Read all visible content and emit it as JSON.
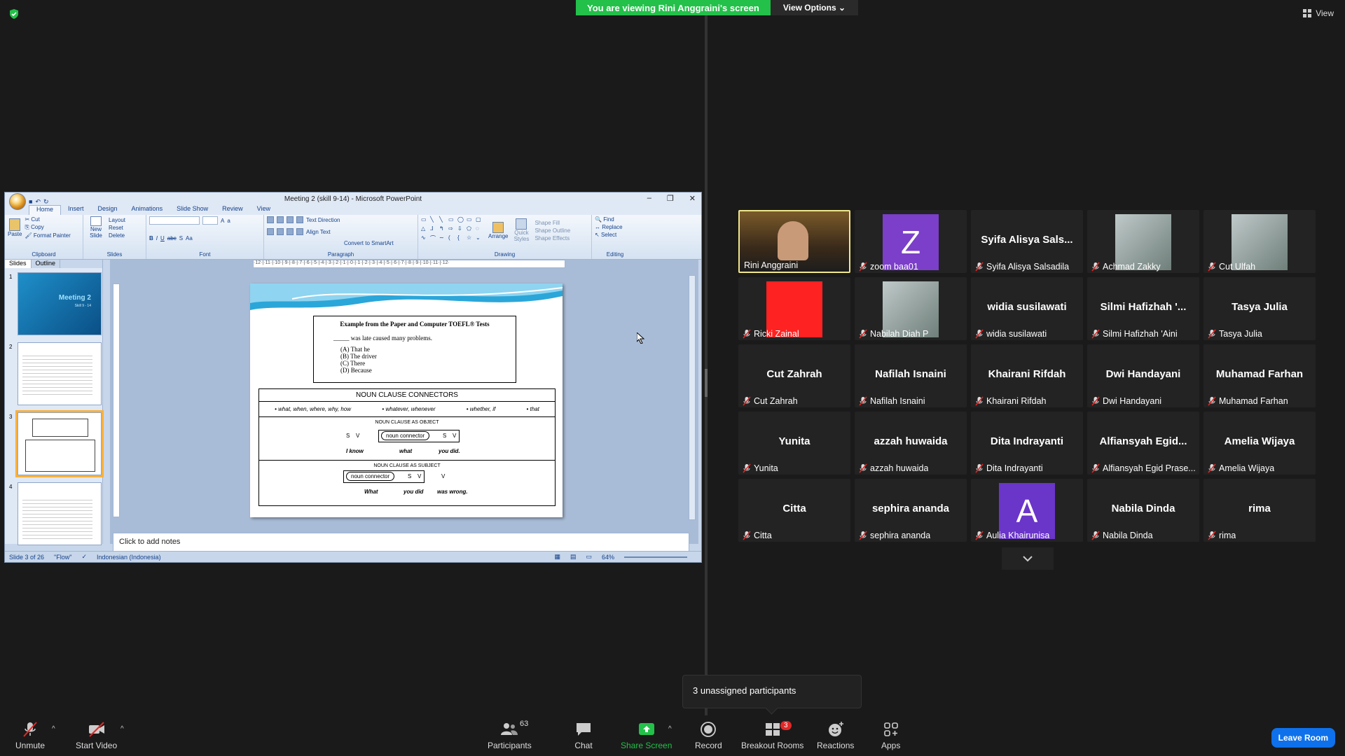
{
  "share_banner": {
    "text": "You are viewing Rini Anggraini's screen",
    "options_label": "View Options"
  },
  "view_label": "View",
  "ppt": {
    "title": "Meeting 2 (skill 9-14) - Microsoft PowerPoint",
    "tabs": [
      "Home",
      "Insert",
      "Design",
      "Animations",
      "Slide Show",
      "Review",
      "View"
    ],
    "ribbon": {
      "clipboard": {
        "paste": "Paste",
        "cut": "Cut",
        "copy": "Copy",
        "format_painter": "Format Painter",
        "label": "Clipboard"
      },
      "slides": {
        "new_slide": "New Slide",
        "layout": "Layout",
        "reset": "Reset",
        "delete": "Delete",
        "label": "Slides"
      },
      "font": {
        "label": "Font"
      },
      "paragraph": {
        "text_direction": "Text Direction",
        "align_text": "Align Text",
        "convert": "Convert to SmartArt",
        "label": "Paragraph"
      },
      "drawing": {
        "arrange": "Arrange",
        "quick_styles": "Quick Styles",
        "shape_fill": "Shape Fill",
        "shape_outline": "Shape Outline",
        "shape_effects": "Shape Effects",
        "label": "Drawing"
      },
      "editing": {
        "find": "Find",
        "replace": "Replace",
        "select": "Select",
        "label": "Editing"
      }
    },
    "panel_tabs": [
      "Slides",
      "Outline"
    ],
    "thumb1_title": "Meeting 2",
    "thumb1_sub": "Skill 9 - 14",
    "slide": {
      "toefl_header": "Example from the Paper and Computer TOEFL® Tests",
      "question": "_____ was late caused many problems.",
      "options": [
        "(A)   That he",
        "(B)   The driver",
        "(C)   There",
        "(D)   Because"
      ],
      "nc_header": "NOUN CLAUSE CONNECTORS",
      "nc_list": [
        "• what, when, where, why, how",
        "• whatever, whenever",
        "• whether, if",
        "• that"
      ],
      "nc_object_caption": "NOUN CLAUSE AS OBJECT",
      "nc_subject_caption": "NOUN CLAUSE AS SUBJECT",
      "s": "S",
      "v": "V",
      "noun_connector": "noun connector",
      "ex1": [
        "I know",
        "what",
        "you did."
      ],
      "ex2": [
        "What",
        "you did",
        "was wrong."
      ]
    },
    "notes_placeholder": "Click to add notes",
    "status": {
      "slide": "Slide 3 of 26",
      "theme": "\"Flow\"",
      "language": "Indonesian (Indonesia)",
      "zoom": "64%"
    }
  },
  "gallery": [
    {
      "tile_name": "",
      "label": "Rini Anggraini",
      "avatar": "video",
      "muted": false,
      "speaking": true
    },
    {
      "tile_name": "",
      "label": "zoom baa01",
      "avatar": "Z",
      "avatar_color": "#7b3fc9",
      "muted": true
    },
    {
      "tile_name": "Syifa  Alisya  Sals...",
      "label": "Syifa Alisya Salsadila",
      "muted": true
    },
    {
      "tile_name": "",
      "label": "Achmad Zakky",
      "avatar": "image",
      "muted": true
    },
    {
      "tile_name": "",
      "label": "Cut Ulfah",
      "avatar": "image",
      "muted": true
    },
    {
      "tile_name": "",
      "label": "Ricki Zainal",
      "avatar": "red",
      "muted": true
    },
    {
      "tile_name": "",
      "label": "Nabilah Diah P",
      "avatar": "image",
      "muted": true
    },
    {
      "tile_name": "widia  susilawati",
      "label": "widia susilawati",
      "muted": true
    },
    {
      "tile_name": "Silmi  Hafizhah  '...",
      "label": "Silmi Hafizhah 'Aini",
      "muted": true
    },
    {
      "tile_name": "Tasya  Julia",
      "label": "Tasya Julia",
      "muted": true
    },
    {
      "tile_name": "Cut  Zahrah",
      "label": "Cut Zahrah",
      "muted": true
    },
    {
      "tile_name": "Nafilah  Isnaini",
      "label": "Nafilah Isnaini",
      "muted": true
    },
    {
      "tile_name": "Khairani  Rifdah",
      "label": "Khairani Rifdah",
      "muted": true
    },
    {
      "tile_name": "Dwi  Handayani",
      "label": "Dwi Handayani",
      "muted": true
    },
    {
      "tile_name": "Muhamad  Farhan",
      "label": "Muhamad Farhan",
      "muted": true
    },
    {
      "tile_name": "Yunita",
      "label": "Yunita",
      "muted": true
    },
    {
      "tile_name": "azzah  huwaida",
      "label": "azzah huwaida",
      "muted": true
    },
    {
      "tile_name": "Dita  Indrayanti",
      "label": "Dita Indrayanti",
      "muted": true
    },
    {
      "tile_name": "Alfiansyah  Egid...",
      "label": "Alfiansyah Egid Prase...",
      "muted": true
    },
    {
      "tile_name": "Amelia  Wijaya",
      "label": "Amelia Wijaya",
      "muted": true
    },
    {
      "tile_name": "Citta",
      "label": "Citta",
      "muted": true
    },
    {
      "tile_name": "sephira  ananda",
      "label": "sephira ananda",
      "muted": true
    },
    {
      "tile_name": "",
      "label": "Aulia Khairunisa",
      "avatar": "A",
      "avatar_color": "#6a35c9",
      "muted": true
    },
    {
      "tile_name": "Nabila  Dinda",
      "label": "Nabila Dinda",
      "muted": true
    },
    {
      "tile_name": "rima",
      "label": "rima",
      "muted": true
    }
  ],
  "unassigned_text": "3 unassigned participants",
  "toolbar": {
    "unmute": "Unmute",
    "start_video": "Start Video",
    "participants": "Participants",
    "participants_count": "63",
    "chat": "Chat",
    "share_screen": "Share Screen",
    "record": "Record",
    "breakout_rooms": "Breakout Rooms",
    "breakout_badge": "3",
    "reactions": "Reactions",
    "apps": "Apps",
    "leave_room": "Leave Room"
  },
  "colors": {
    "share_green": "#23c04a",
    "leave_blue": "#0e71eb",
    "speaker_border": "#f0e68c",
    "mute_red": "#e02828"
  }
}
